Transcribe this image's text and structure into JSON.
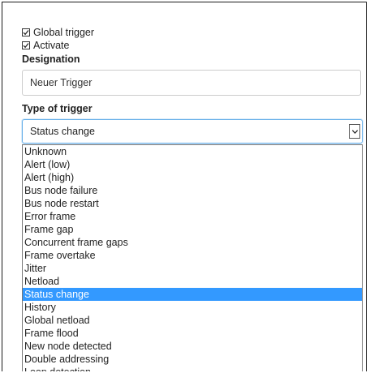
{
  "form": {
    "global_trigger": {
      "label": "Global trigger",
      "checked": true
    },
    "activate": {
      "label": "Activate",
      "checked": true
    },
    "designation": {
      "label": "Designation",
      "value": "Neuer Trigger"
    },
    "type_of_trigger": {
      "label": "Type of trigger",
      "selected": "Status change",
      "options": [
        "Unknown",
        "Alert (low)",
        "Alert (high)",
        "Bus node failure",
        "Bus node restart",
        "Error frame",
        "Frame gap",
        "Concurrent frame gaps",
        "Frame overtake",
        "Jitter",
        "Netload",
        "Status change",
        "History",
        "Global netload",
        "Frame flood",
        "New node detected",
        "Double addressing",
        "Loop detection"
      ]
    }
  },
  "colors": {
    "selected_option_bg": "#3399ff",
    "select_focus_border": "#66afe9"
  },
  "icons": {
    "checkbox": "checkmark-icon",
    "dropdown": "chevron-down-icon"
  }
}
